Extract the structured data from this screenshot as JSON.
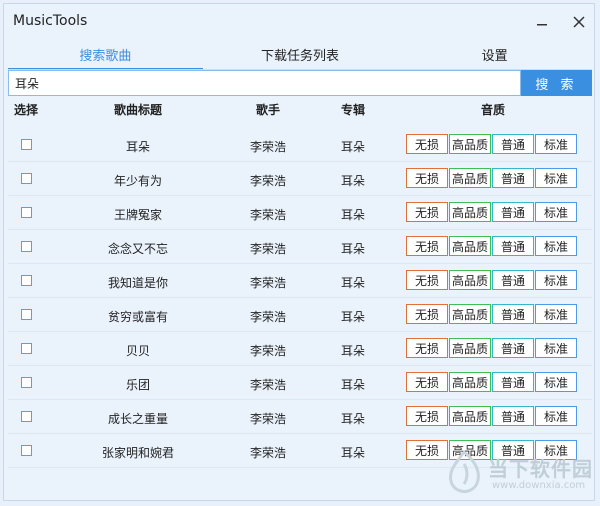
{
  "window": {
    "title": "MusicTools"
  },
  "tabs": [
    {
      "label": "搜索歌曲",
      "active": true
    },
    {
      "label": "下载任务列表",
      "active": false
    },
    {
      "label": "设置",
      "active": false
    }
  ],
  "search": {
    "value": "耳朵",
    "button_label": "搜 索"
  },
  "table": {
    "headers": {
      "select": "选择",
      "title": "歌曲标题",
      "artist": "歌手",
      "album": "专辑",
      "quality": "音质"
    },
    "quality_labels": [
      "无损",
      "高品质",
      "普通",
      "标准"
    ],
    "rows": [
      {
        "title": "耳朵",
        "artist": "李荣浩",
        "album": "耳朵"
      },
      {
        "title": "年少有为",
        "artist": "李荣浩",
        "album": "耳朵"
      },
      {
        "title": "王牌冤家",
        "artist": "李荣浩",
        "album": "耳朵"
      },
      {
        "title": "念念又不忘",
        "artist": "李荣浩",
        "album": "耳朵"
      },
      {
        "title": "我知道是你",
        "artist": "李荣浩",
        "album": "耳朵"
      },
      {
        "title": "贫穷或富有",
        "artist": "李荣浩",
        "album": "耳朵"
      },
      {
        "title": "贝贝",
        "artist": "李荣浩",
        "album": "耳朵"
      },
      {
        "title": "乐团",
        "artist": "李荣浩",
        "album": "耳朵"
      },
      {
        "title": "成长之重量",
        "artist": "李荣浩",
        "album": "耳朵"
      },
      {
        "title": "张家明和婉君",
        "artist": "李荣浩",
        "album": "耳朵"
      }
    ]
  },
  "colors": {
    "accent": "#3b8fe0",
    "lossless": "#e0703a",
    "high": "#3cbf55",
    "normal": "#35b8c7",
    "standard": "#4d9be8"
  },
  "watermark": {
    "name": "当下软件园",
    "url": "www.downxia.com"
  }
}
